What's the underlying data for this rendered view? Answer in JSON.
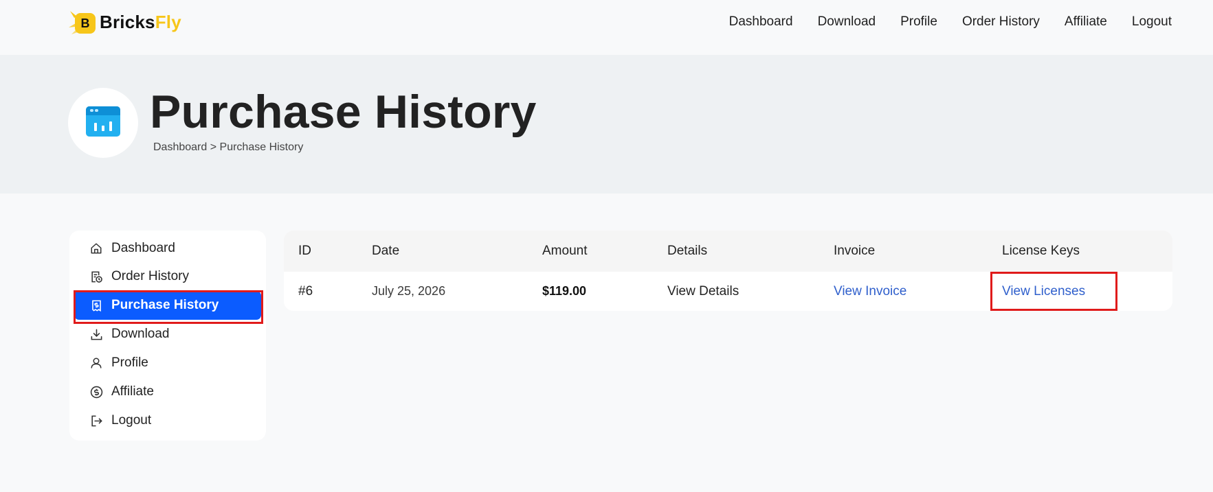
{
  "brand": {
    "name_part1": "Bricks",
    "name_part2": "Fly",
    "logo_letter": "B",
    "accent_color": "#f7c61a"
  },
  "topnav": {
    "items": [
      {
        "label": "Dashboard"
      },
      {
        "label": "Download"
      },
      {
        "label": "Profile"
      },
      {
        "label": "Order History"
      },
      {
        "label": "Affiliate"
      },
      {
        "label": "Logout"
      }
    ]
  },
  "hero": {
    "title": "Purchase History",
    "icon": "browser-chart-icon",
    "breadcrumb": {
      "home": "Dashboard",
      "separator": ">",
      "current": "Purchase History"
    }
  },
  "sidebar": {
    "active_color": "#0b5cff",
    "items": [
      {
        "label": "Dashboard",
        "icon": "home-icon"
      },
      {
        "label": "Order History",
        "icon": "order-history-icon"
      },
      {
        "label": "Purchase History",
        "icon": "receipt-dollar-icon",
        "active": true
      },
      {
        "label": "Download",
        "icon": "download-icon"
      },
      {
        "label": "Profile",
        "icon": "user-icon"
      },
      {
        "label": "Affiliate",
        "icon": "dollar-circle-icon"
      },
      {
        "label": "Logout",
        "icon": "logout-icon"
      }
    ]
  },
  "table": {
    "headers": {
      "id": "ID",
      "date": "Date",
      "amount": "Amount",
      "details": "Details",
      "invoice": "Invoice",
      "license": "License Keys"
    },
    "rows": [
      {
        "id": "#6",
        "date": "July 25, 2026",
        "amount": "$119.00",
        "details": "View Details",
        "invoice": "View Invoice",
        "license": "View Licenses"
      }
    ],
    "link_color": "#2f5fcc"
  },
  "highlights": {
    "color": "#e01b1b"
  }
}
